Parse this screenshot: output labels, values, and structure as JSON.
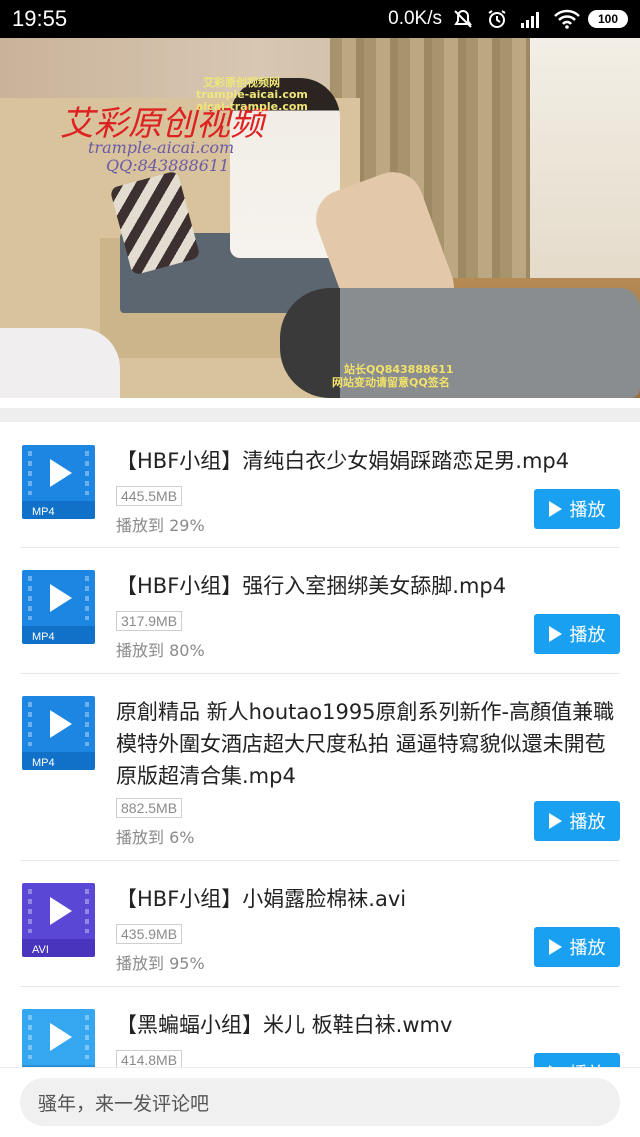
{
  "status_bar": {
    "time": "19:55",
    "net_speed": "0.0K/s",
    "battery": "100",
    "icons": [
      "mute-icon",
      "alarm-icon",
      "signal-icon",
      "wifi-icon",
      "battery-icon"
    ]
  },
  "video": {
    "watermark_main": "艾彩原创视频",
    "watermark_url": "trample-aicai.com",
    "watermark_qq": "QQ:843888611",
    "watermark_small_1": "艾彩原创视频网",
    "watermark_small_2": "trample-aicai.com",
    "watermark_small_3": "aicai-trample.com",
    "watermark_bottom_1": "站长QQ843888611",
    "watermark_bottom_2": "网站变动请留意QQ签名"
  },
  "play_label": "播放",
  "items": [
    {
      "title": "【HBF小组】清纯白衣少女娟娟踩踏恋足男.mp4",
      "size": "445.5MB",
      "progress": "播放到 29%",
      "format": "MP4",
      "color_top": "#1d86e3",
      "color_bottom": "#1170c8"
    },
    {
      "title": "【HBF小组】强行入室捆绑美女舔脚.mp4",
      "size": "317.9MB",
      "progress": "播放到 80%",
      "format": "MP4",
      "color_top": "#1d86e3",
      "color_bottom": "#1170c8"
    },
    {
      "title": "原創精品 新人houtao1995原創系列新作-高顏值兼職模特外圍女酒店超大尺度私拍 逼逼特寫貌似還未開苞 原版超清合集.mp4",
      "size": "882.5MB",
      "progress": "播放到 6%",
      "format": "MP4",
      "color_top": "#1d86e3",
      "color_bottom": "#1170c8"
    },
    {
      "title": "【HBF小组】小娟露脸棉袜.avi",
      "size": "435.9MB",
      "progress": "播放到 95%",
      "format": "AVI",
      "color_top": "#5b47d6",
      "color_bottom": "#4935bd"
    },
    {
      "title": "【黑蝙蝠小组】米儿 板鞋白袜.wmv",
      "size": "414.8MB",
      "progress": "",
      "format": "",
      "color_top": "#35a7f0",
      "color_bottom": "#2a90d8"
    }
  ],
  "comment": {
    "placeholder": "骚年，来一发评论吧"
  }
}
